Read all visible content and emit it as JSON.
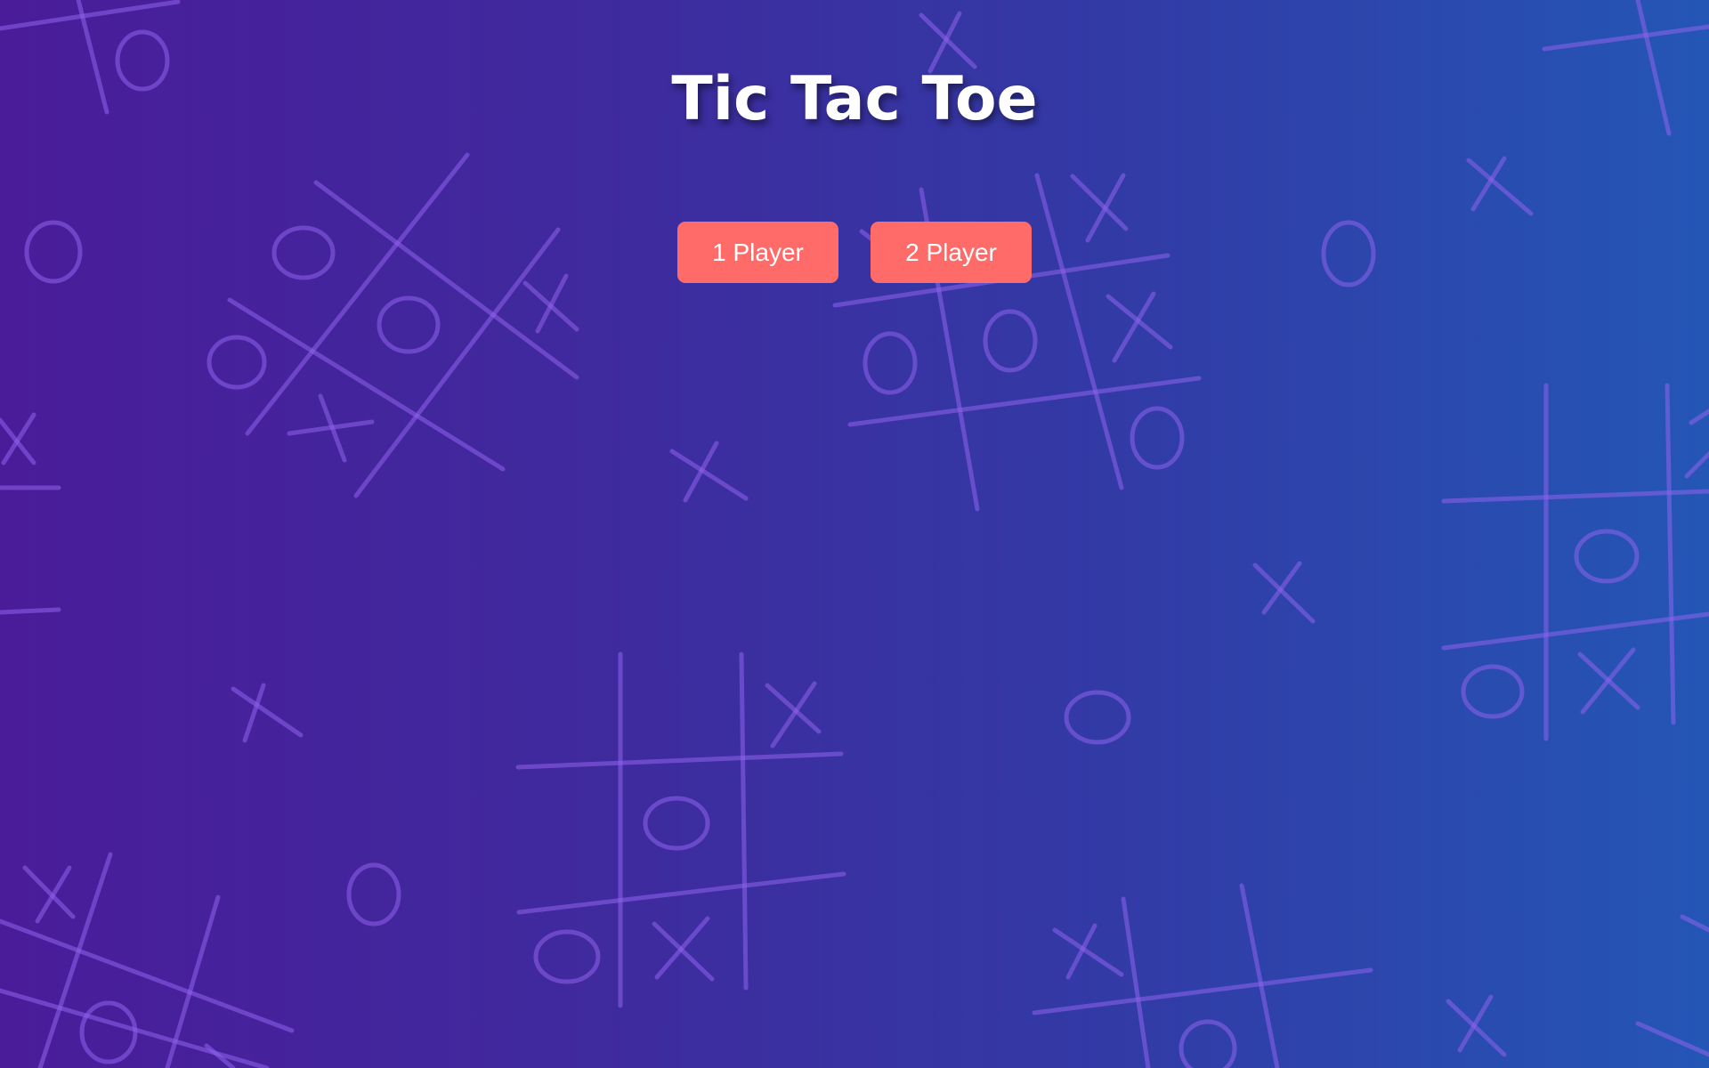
{
  "page": {
    "title": "Tic Tac Toe"
  },
  "mode_buttons": [
    {
      "label": "1 Player"
    },
    {
      "label": "2 Player"
    }
  ],
  "colors": {
    "background_start": "#4a1c9a",
    "background_end": "#2456b6",
    "button": "#ff6b68",
    "doodle_stroke": "#8a5ee6",
    "title_text": "#ffffff"
  },
  "background_icons": [
    "tic-tac-toe-board-doodle",
    "x-mark-doodle",
    "o-mark-doodle"
  ]
}
